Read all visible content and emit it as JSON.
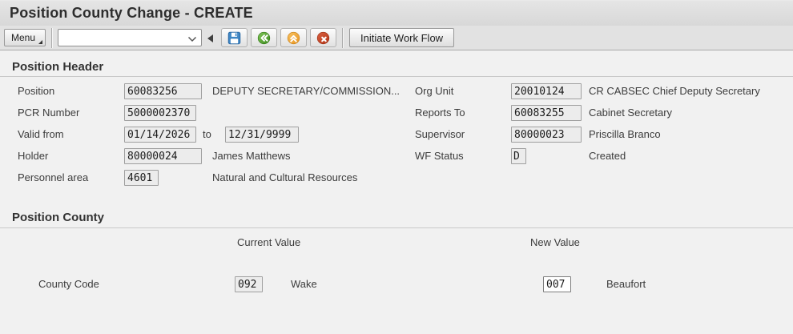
{
  "window": {
    "title": "Position County Change - CREATE"
  },
  "toolbar": {
    "menu_label": "Menu",
    "command_field": {
      "value": "",
      "placeholder": ""
    },
    "initiate_label": "Initiate Work Flow",
    "icons": {
      "save": "save-icon",
      "back": "back-icon",
      "exit": "exit-icon",
      "cancel": "cancel-icon",
      "dropdown": "chevron-down-icon",
      "collapse": "triangle-left-icon"
    }
  },
  "position_header": {
    "title": "Position Header",
    "fields": {
      "position": {
        "label": "Position",
        "value": "60083256",
        "desc": "DEPUTY SECRETARY/COMMISSION..."
      },
      "pcr_number": {
        "label": "PCR Number",
        "value": "5000002370"
      },
      "valid": {
        "label": "Valid from",
        "from": "01/14/2026",
        "to_label": "to",
        "to": "12/31/9999"
      },
      "holder": {
        "label": "Holder",
        "value": "80000024",
        "desc": "James Matthews"
      },
      "personnel_area": {
        "label": "Personnel area",
        "value": "4601",
        "desc": "Natural and Cultural Resources"
      },
      "org_unit": {
        "label": "Org Unit",
        "value": "20010124",
        "desc": "CR CABSEC Chief Deputy Secretary"
      },
      "reports_to": {
        "label": "Reports To",
        "value": "60083255",
        "desc": "Cabinet Secretary"
      },
      "supervisor": {
        "label": "Supervisor",
        "value": "80000023",
        "desc": "Priscilla Branco"
      },
      "wf_status": {
        "label": "WF Status",
        "value": "D",
        "desc": "Created"
      }
    }
  },
  "position_county": {
    "title": "Position County",
    "columns": {
      "current": "Current Value",
      "new": "New Value"
    },
    "county_code": {
      "label": "County Code",
      "current_value": "092",
      "current_desc": "Wake",
      "new_value": "007",
      "new_desc": "Beaufort"
    }
  },
  "colors": {
    "save_blue": "#3f86c4",
    "back_green": "#4f9d2f",
    "exit_orange": "#efa238",
    "cancel_red": "#c2402a"
  }
}
